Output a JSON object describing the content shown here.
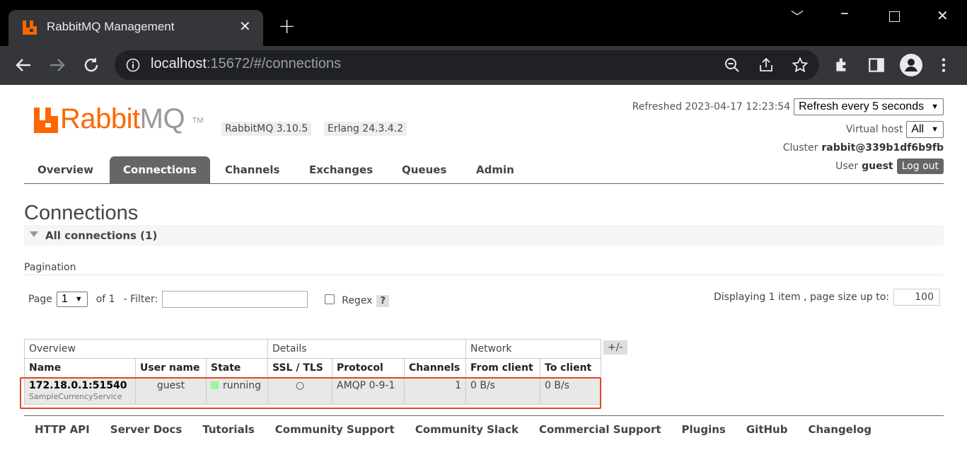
{
  "browser": {
    "tab_title": "RabbitMQ Management",
    "url_host": "localhost",
    "url_path": ":15672/#/connections",
    "icons": [
      "rabbitmq-favicon",
      "close-icon",
      "plus-icon",
      "chevron-down-icon",
      "minimize-icon",
      "maximize-icon",
      "close-window-icon",
      "back-arrow-icon",
      "forward-arrow-icon",
      "reload-icon",
      "info-icon",
      "zoom-out-icon",
      "share-icon",
      "star-icon",
      "extensions-icon",
      "sidepanel-icon",
      "profile-icon",
      "kebab-menu-icon"
    ]
  },
  "header": {
    "logo_rabbit": "Rabbit",
    "logo_mq": "MQ",
    "logo_tm": "TM",
    "version": "RabbitMQ 3.10.5",
    "erlang": "Erlang 24.3.4.2",
    "refreshed": "Refreshed 2023-04-17 12:23:54",
    "refresh_option": "Refresh every 5 seconds",
    "vhost_label": "Virtual host",
    "vhost_value": "All",
    "cluster_label": "Cluster",
    "cluster_name": "rabbit@339b1df6b9fb",
    "user_label": "User",
    "user_name": "guest",
    "logout": "Log out"
  },
  "nav": {
    "tabs": [
      "Overview",
      "Connections",
      "Channels",
      "Exchanges",
      "Queues",
      "Admin"
    ],
    "active": "Connections"
  },
  "main": {
    "title": "Connections",
    "section": "All connections (1)",
    "pagination_label": "Pagination",
    "page_label": "Page",
    "page_value": "1",
    "of_label": "of 1",
    "filter_label": "- Filter:",
    "regex_label": "Regex",
    "regex_help": "?",
    "display_text": "Displaying 1 item , page size up to:",
    "page_size": "100"
  },
  "table": {
    "groups": [
      "Overview",
      "Details",
      "Network"
    ],
    "plus_minus": "+/-",
    "columns": [
      "Name",
      "User name",
      "State",
      "SSL / TLS",
      "Protocol",
      "Channels",
      "From client",
      "To client"
    ],
    "rows": [
      {
        "name": "172.18.0.1:51540",
        "client": "SampleCurrencyService",
        "user": "guest",
        "state": "running",
        "ssl": "○",
        "protocol": "AMQP 0-9-1",
        "channels": "1",
        "from_client": "0 B/s",
        "to_client": "0 B/s"
      }
    ]
  },
  "footer": {
    "links": [
      "HTTP API",
      "Server Docs",
      "Tutorials",
      "Community Support",
      "Community Slack",
      "Commercial Support",
      "Plugins",
      "GitHub",
      "Changelog"
    ]
  },
  "colors": {
    "brand": "#ff6600",
    "nav_active": "#666666",
    "running": "#98f898",
    "highlight": "#e0472a"
  }
}
